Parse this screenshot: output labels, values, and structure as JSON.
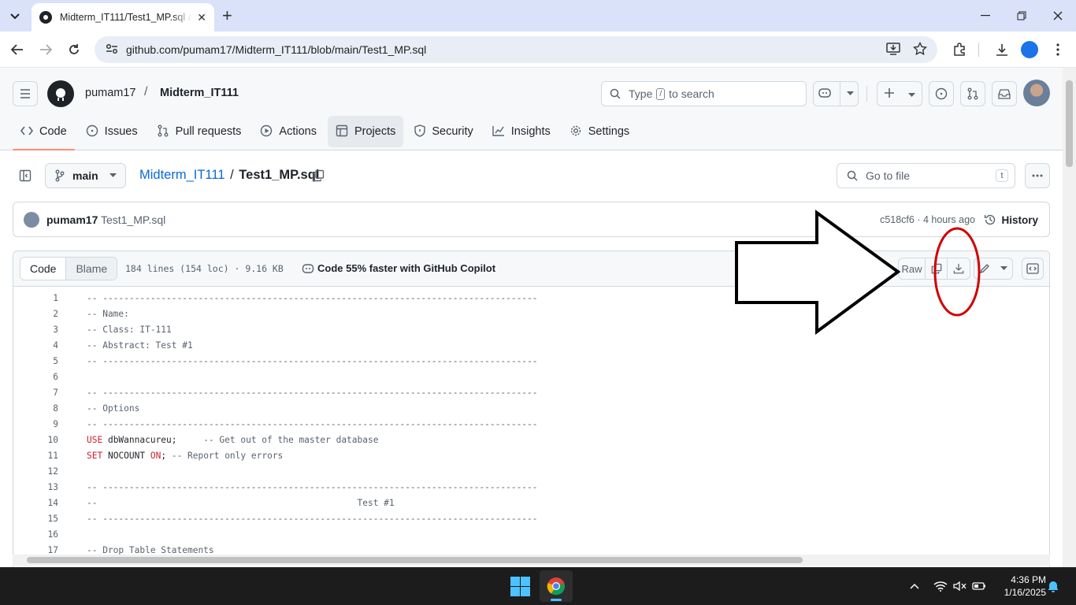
{
  "browser": {
    "tab_title": "Midterm_IT111/Test1_MP.sql at main",
    "url": "github.com/pumam17/Midterm_IT111/blob/main/Test1_MP.sql",
    "new_tab": "+"
  },
  "github": {
    "owner": "pumam17",
    "separator": "/",
    "repo": "Midterm_IT111",
    "search_prefix": "Type",
    "search_key": "/",
    "search_suffix": "to search",
    "nav": [
      {
        "label": "Code",
        "icon": "code-icon"
      },
      {
        "label": "Issues",
        "icon": "issue-icon"
      },
      {
        "label": "Pull requests",
        "icon": "pull-request-icon"
      },
      {
        "label": "Actions",
        "icon": "play-icon"
      },
      {
        "label": "Projects",
        "icon": "table-icon"
      },
      {
        "label": "Security",
        "icon": "shield-icon"
      },
      {
        "label": "Insights",
        "icon": "graph-icon"
      },
      {
        "label": "Settings",
        "icon": "gear-icon"
      }
    ]
  },
  "file": {
    "branch": "main",
    "repo_link": "Midterm_IT111",
    "crumb_sep": "/",
    "filename": "Test1_MP.sql",
    "goto_placeholder": "Go to file",
    "goto_key": "t",
    "commit_author": "pumam17",
    "commit_message": "Test1_MP.sql",
    "commit_meta": "c518cf6 · 4 hours ago",
    "history_label": "History",
    "view_code": "Code",
    "view_blame": "Blame",
    "file_info": "184 lines (154 loc) · 9.16 KB",
    "copilot_text": "Code 55% faster with GitHub Copilot",
    "raw_label": "Raw"
  },
  "code_lines": [
    {
      "n": "1",
      "text": "-- ----------------------------------------------------------------------------------"
    },
    {
      "n": "2",
      "text": "-- Name:"
    },
    {
      "n": "3",
      "text": "-- Class: IT-111"
    },
    {
      "n": "4",
      "text": "-- Abstract: Test #1"
    },
    {
      "n": "5",
      "text": "-- ----------------------------------------------------------------------------------"
    },
    {
      "n": "6",
      "text": ""
    },
    {
      "n": "7",
      "text": "-- ----------------------------------------------------------------------------------"
    },
    {
      "n": "8",
      "text": "-- Options"
    },
    {
      "n": "9",
      "text": "-- ----------------------------------------------------------------------------------"
    },
    {
      "n": "10",
      "text": "USE dbWannacureu;     -- Get out of the master database"
    },
    {
      "n": "11",
      "text": "SET NOCOUNT ON; -- Report only errors"
    },
    {
      "n": "12",
      "text": ""
    },
    {
      "n": "13",
      "text": "-- ----------------------------------------------------------------------------------"
    },
    {
      "n": "14",
      "text": "--                                                 Test #1"
    },
    {
      "n": "15",
      "text": "-- ----------------------------------------------------------------------------------"
    },
    {
      "n": "16",
      "text": ""
    },
    {
      "n": "17",
      "text": "-- Drop Table Statements"
    }
  ],
  "taskbar": {
    "time": "4:36 PM",
    "date": "1/16/2025"
  },
  "colors": {
    "accent_underline": "#fd8c73",
    "link": "#0969da",
    "keyword": "#cf222e",
    "annotation_red": "#d00000"
  }
}
